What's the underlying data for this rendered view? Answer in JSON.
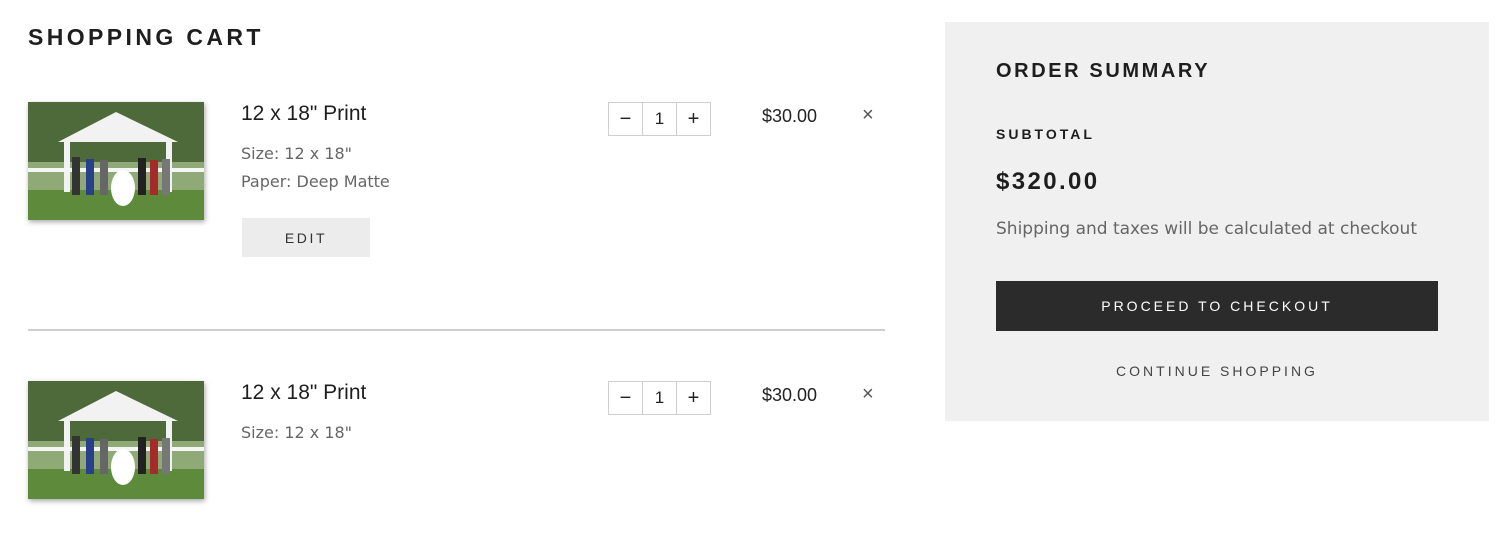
{
  "page": {
    "title": "SHOPPING CART"
  },
  "cart": {
    "items": [
      {
        "name": "12 x 18\" Print",
        "options": [
          "Size: 12 x 18\"",
          "Paper: Deep Matte"
        ],
        "edit_label": "EDIT",
        "quantity": "1",
        "minus_symbol": "−",
        "plus_symbol": "+",
        "price": "$30.00",
        "remove_symbol": "×",
        "thumbnail_icon": "wedding-photo-thumbnail"
      },
      {
        "name": "12 x 18\" Print",
        "options": [
          "Size: 12 x 18\""
        ],
        "quantity": "1",
        "minus_symbol": "−",
        "plus_symbol": "+",
        "price": "$30.00",
        "remove_symbol": "×",
        "thumbnail_icon": "wedding-photo-thumbnail"
      }
    ]
  },
  "summary": {
    "title": "ORDER SUMMARY",
    "subtotal_label": "SUBTOTAL",
    "subtotal_value": "$320.00",
    "note": "Shipping and taxes will be calculated at checkout",
    "checkout_label": "PROCEED TO CHECKOUT",
    "continue_label": "CONTINUE SHOPPING"
  },
  "colors": {
    "summary_bg": "#f0f0f0",
    "checkout_bg": "#2b2b2b",
    "edit_bg": "#ececec",
    "text": "#1e1e1e",
    "muted": "#666666"
  }
}
